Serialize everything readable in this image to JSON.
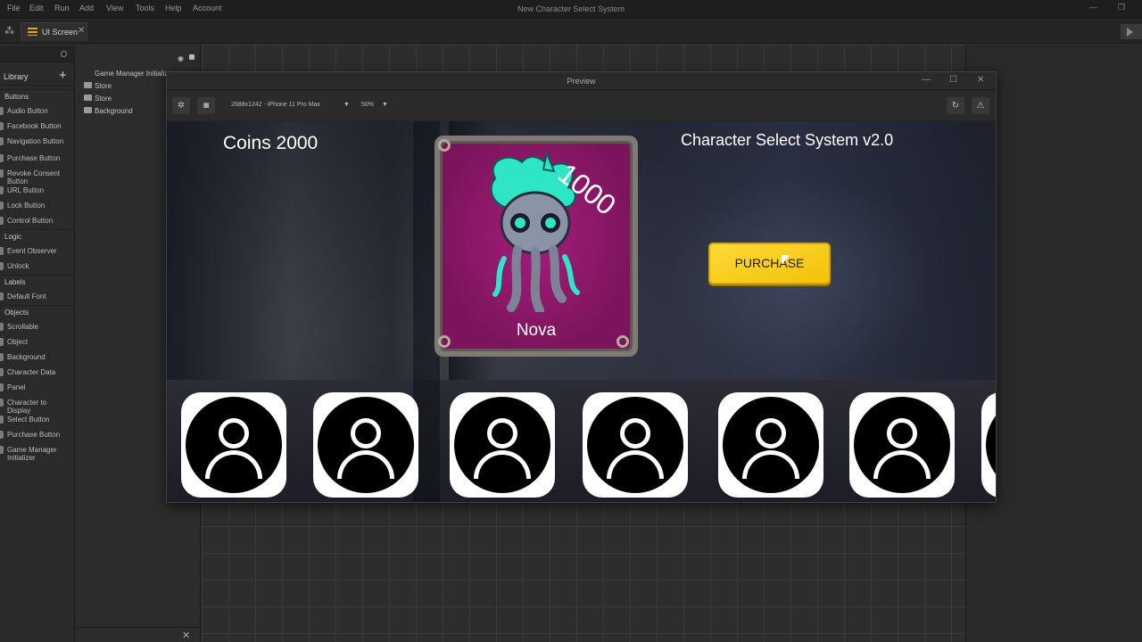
{
  "menubar": {
    "items": [
      "File",
      "Edit",
      "Run",
      "Add",
      "View",
      "Tools",
      "Help",
      "Account"
    ],
    "window_title": "New Character Select System"
  },
  "tabs": {
    "active_tab": "UI Screen"
  },
  "library": {
    "title": "Library",
    "items": [
      {
        "label": "Buttons",
        "type": "category"
      },
      {
        "label": "Audio Button",
        "type": "item"
      },
      {
        "label": "Facebook Button",
        "type": "item"
      },
      {
        "label": "Navigation Button",
        "type": "item"
      },
      {
        "label": "Purchase Button",
        "type": "item"
      },
      {
        "label": "Revoke Consent Button",
        "type": "item"
      },
      {
        "label": "URL Button",
        "type": "item"
      },
      {
        "label": "Lock Button",
        "type": "item"
      },
      {
        "label": "Control Button",
        "type": "item"
      },
      {
        "label": "Logic",
        "type": "category"
      },
      {
        "label": "Event Observer",
        "type": "item"
      },
      {
        "label": "Unlock",
        "type": "item"
      },
      {
        "label": "Labels",
        "type": "category"
      },
      {
        "label": "Default Font",
        "type": "item"
      },
      {
        "label": "Objects",
        "type": "category"
      },
      {
        "label": "Scrollable",
        "type": "item"
      },
      {
        "label": "Object",
        "type": "item"
      },
      {
        "label": "Background",
        "type": "item"
      },
      {
        "label": "Character Data",
        "type": "item"
      },
      {
        "label": "Panel",
        "type": "item"
      },
      {
        "label": "Character to Display",
        "type": "item"
      },
      {
        "label": "Select Button",
        "type": "item"
      },
      {
        "label": "Purchase Button",
        "type": "item"
      },
      {
        "label": "Game Manager Initializer",
        "type": "item"
      }
    ]
  },
  "hierarchy": {
    "items": [
      "Game Manager Initializ",
      "Store",
      "Store",
      "Background"
    ]
  },
  "preview": {
    "title": "Preview",
    "device": "2688x1242 - iPhone 11 Pro Max",
    "zoom": "50%"
  },
  "game": {
    "coins_label": "Coins 2000",
    "app_title": "Character Select System v2.0",
    "card": {
      "price": "1000",
      "name": "Nova"
    },
    "purchase_label": "PURCHASE",
    "slot_count": 7
  },
  "colors": {
    "accent": "#e5a22a",
    "purchase_button": "#f8cd1c",
    "card_bg": "#8e1a6b",
    "character_teal": "#2ee6c5"
  }
}
